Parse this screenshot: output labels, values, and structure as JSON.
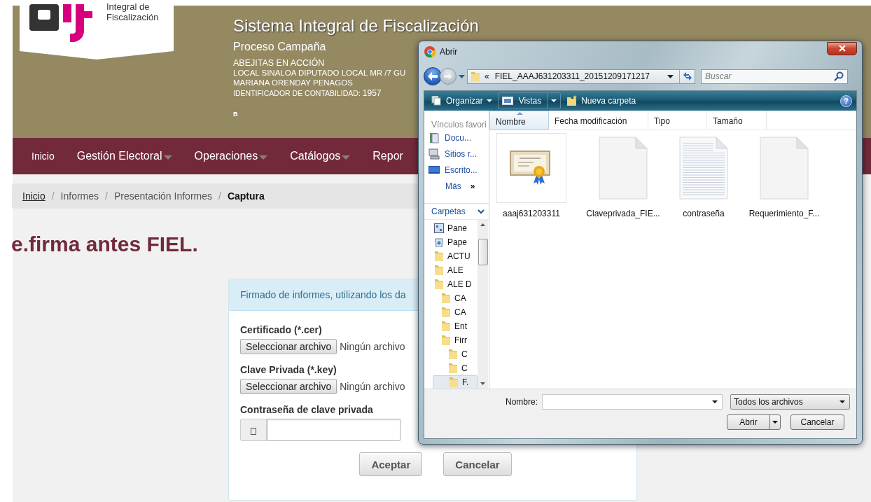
{
  "header": {
    "logo_text": "Integral de Fiscalización",
    "title": "Sistema Integral de Fiscalización",
    "subtitle": "Proceso Campaña",
    "party": "ABEJITAS EN ACCIÓN",
    "lines": [
      "LOCAL SINALOA DIPUTADO LOCAL MR /7 GU",
      "MARIANA ORENDAY PENAGOS"
    ],
    "id_label": "IDENTIFICADOR DE CONTABILIDAD:",
    "id_value": "1957",
    "note": "B"
  },
  "nav": [
    {
      "label": "Inicio",
      "dropdown": false
    },
    {
      "label": "Gestión Electoral",
      "dropdown": true
    },
    {
      "label": "Operaciones",
      "dropdown": true
    },
    {
      "label": "Catálogos",
      "dropdown": true
    },
    {
      "label": "Repor",
      "dropdown": false
    }
  ],
  "breadcrumb_separator": "/",
  "breadcrumb": [
    {
      "label": "Inicio",
      "kind": "link"
    },
    {
      "label": "Informes",
      "kind": "plain"
    },
    {
      "label": "Presentación Informes",
      "kind": "plain"
    },
    {
      "label": "Captura",
      "kind": "current"
    }
  ],
  "heading": "e.firma antes FIEL.",
  "form": {
    "notice": "Firmado de informes, utilizando los da",
    "fields": [
      {
        "kind": "file",
        "label": "Certificado (*.cer)",
        "button": "Seleccionar archivo",
        "status": "Ningún archivo"
      },
      {
        "kind": "file",
        "label": "Clave Privada (*.key)",
        "button": "Seleccionar archivo",
        "status": "Ningún archivo"
      },
      {
        "kind": "password",
        "label": "Contraseña de clave privada"
      }
    ],
    "buttons": [
      "Aceptar",
      "Cancelar"
    ]
  },
  "dialog": {
    "title": "Abrir",
    "address": {
      "prefix": "«",
      "path": "FIEL_AAAJ631203311_20151209171217"
    },
    "search": {
      "placeholder": "Buscar"
    },
    "toolbar": [
      {
        "label": "Organizar",
        "kind": "menu"
      },
      {
        "label": "Vistas",
        "kind": "split"
      },
      {
        "label": "Nueva carpeta",
        "kind": "button"
      }
    ],
    "help": "?",
    "favorites_heading": "Vínculos favori",
    "favorites": [
      {
        "label": "Docu...",
        "kind": "documents"
      },
      {
        "label": "Sitios r...",
        "kind": "computer"
      },
      {
        "label": "Escrito...",
        "kind": "desktop"
      }
    ],
    "more": "Más",
    "more_glyph": "»",
    "folders_heading": "Carpetas",
    "tree": [
      {
        "label": "Pane",
        "kind": "panel",
        "selected": false
      },
      {
        "label": "Pape",
        "kind": "bin",
        "selected": false
      },
      {
        "label": "ACTU",
        "kind": "folder",
        "selected": false
      },
      {
        "label": "ALE",
        "kind": "folder",
        "selected": false
      },
      {
        "label": "ALE D",
        "kind": "folder",
        "selected": false,
        "children": [
          {
            "label": "CA",
            "kind": "folder",
            "selected": false
          },
          {
            "label": "CA",
            "kind": "folder",
            "selected": false
          },
          {
            "label": "Ent",
            "kind": "folder",
            "selected": false
          },
          {
            "label": "Firr",
            "kind": "folder",
            "selected": false,
            "children": [
              {
                "label": "C",
                "kind": "folder",
                "selected": false
              },
              {
                "label": "C",
                "kind": "folder",
                "selected": false
              },
              {
                "label": "F.",
                "kind": "folder",
                "selected": true
              }
            ]
          }
        ]
      }
    ],
    "columns": [
      {
        "label": "Nombre",
        "sorted": true
      },
      {
        "label": "Fecha modificación",
        "sorted": false
      },
      {
        "label": "Tipo",
        "sorted": false
      },
      {
        "label": "Tamaño",
        "sorted": false
      }
    ],
    "files": [
      {
        "name": "aaaj631203311",
        "kind": "certificate",
        "selected": true
      },
      {
        "name": "Claveprivada_FIE...",
        "kind": "blank",
        "selected": false
      },
      {
        "name": "contraseña",
        "kind": "text",
        "selected": false
      },
      {
        "name": "Requerimiento_F...",
        "kind": "blank",
        "selected": false
      }
    ],
    "filename_label": "Nombre:",
    "filetype": "Todos los archivos",
    "buttons": [
      {
        "label": "Abrir",
        "kind": "split"
      },
      {
        "label": "Cancelar",
        "kind": "plain"
      }
    ]
  }
}
